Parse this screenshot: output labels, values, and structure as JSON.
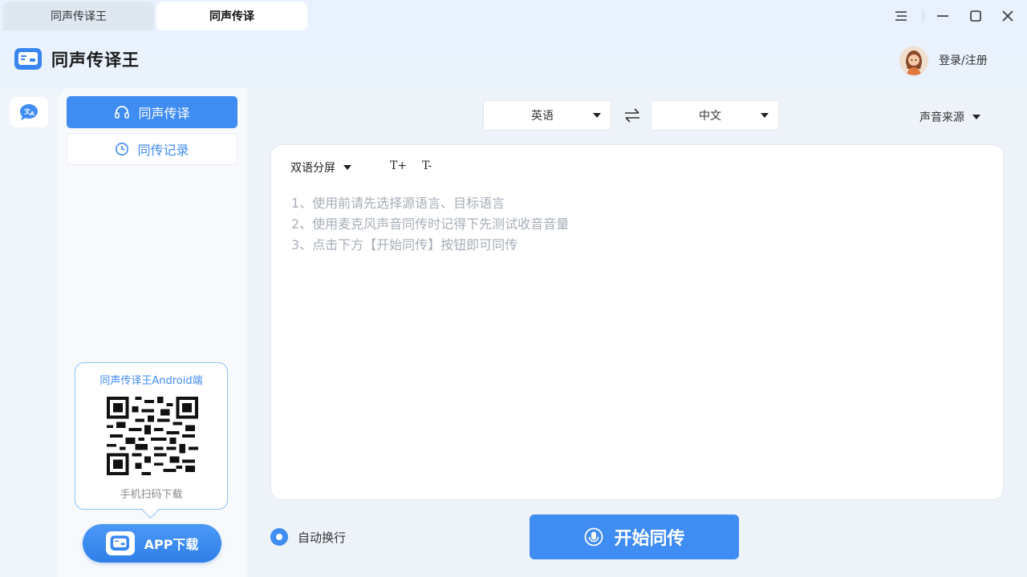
{
  "tabs": [
    {
      "label": "同声传译王"
    },
    {
      "label": "同声传译"
    }
  ],
  "header": {
    "title": "同声传译王",
    "login_label": "登录/注册"
  },
  "sidebar": {
    "items": [
      {
        "label": "同声传译",
        "icon": "headphones-icon",
        "active": true
      },
      {
        "label": "同传记录",
        "icon": "clock-icon",
        "active": false
      }
    ],
    "qr_card": {
      "title": "同声传译王Android端",
      "caption": "手机扫码下载"
    },
    "download_label": "APP下载"
  },
  "toolbar": {
    "source_language": "英语",
    "target_language": "中文",
    "audio_source_label": "声音来源"
  },
  "panel": {
    "mode_label": "双语分屏",
    "font_increase": "T+",
    "font_decrease": "T-",
    "tips": [
      "1、使用前请先选择源语言、目标语言",
      "2、使用麦克风声音同传时记得下先测试收音音量",
      "3、点击下方【开始同传】按钮即可同传"
    ]
  },
  "footer": {
    "auto_wrap_label": "自动换行",
    "auto_wrap_checked": true,
    "start_label": "开始同传"
  },
  "colors": {
    "accent": "#3f8cf2",
    "tip_text": "#a7aeb8"
  }
}
